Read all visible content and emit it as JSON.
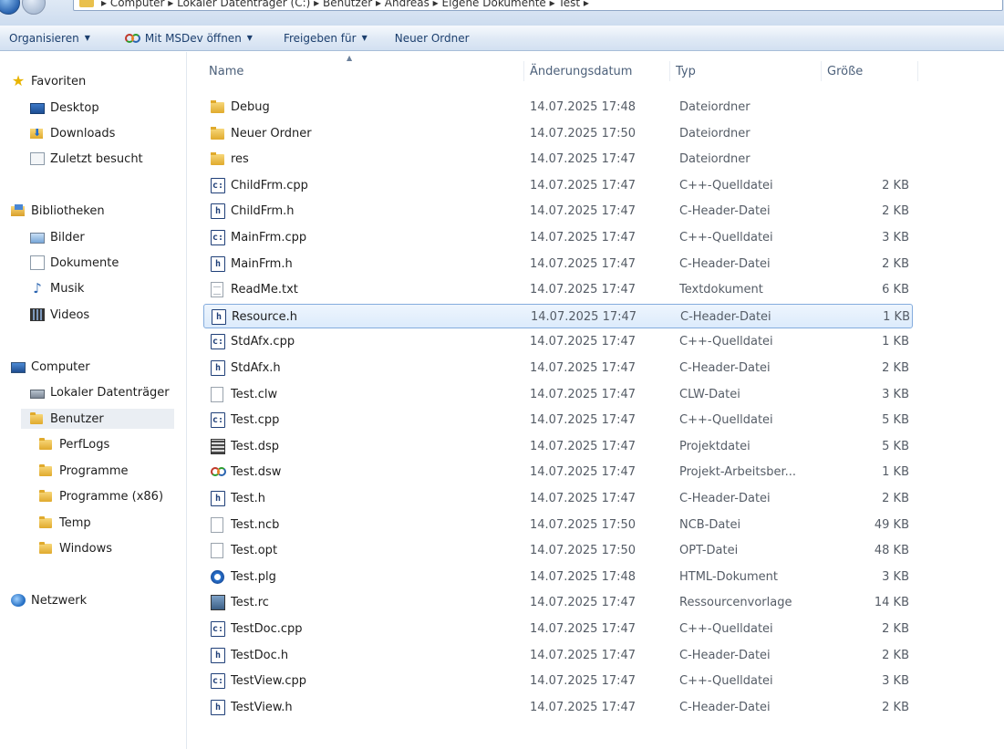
{
  "address": {
    "path": "▸ Computer ▸ Lokaler Datenträger (C:) ▸ Benutzer ▸ Andreas ▸ Eigene Dokumente ▸ Test ▸"
  },
  "toolbar": {
    "organize": "Organisieren",
    "open_with": "Mit MSDev öffnen",
    "share": "Freigeben für",
    "new_folder": "Neuer Ordner"
  },
  "nav": {
    "favorites": "Favoriten",
    "desktop": "Desktop",
    "downloads": "Downloads",
    "recent": "Zuletzt besucht",
    "libraries": "Bibliotheken",
    "pictures": "Bilder",
    "documents": "Dokumente",
    "music": "Musik",
    "videos": "Videos",
    "computer": "Computer",
    "drive": "Lokaler Datenträger",
    "benutzer": "Benutzer",
    "perflogs": "PerfLogs",
    "programme": "Programme",
    "programme_x86": "Programme (x86)",
    "temp": "Temp",
    "windows": "Windows",
    "network": "Netzwerk"
  },
  "columns": {
    "name": "Name",
    "date": "Änderungsdatum",
    "type": "Typ",
    "size": "Größe"
  },
  "files": [
    {
      "name": "Debug",
      "date": "14.07.2025 17:48",
      "type": "Dateiordner",
      "size": "",
      "icon": "folder-icon"
    },
    {
      "name": "Neuer Ordner",
      "date": "14.07.2025 17:50",
      "type": "Dateiordner",
      "size": "",
      "icon": "folder-icon"
    },
    {
      "name": "res",
      "date": "14.07.2025 17:47",
      "type": "Dateiordner",
      "size": "",
      "icon": "folder-icon"
    },
    {
      "name": "ChildFrm.cpp",
      "date": "14.07.2025 17:47",
      "type": "C++-Quelldatei",
      "size": "2 KB",
      "icon": "cpp-file-icon"
    },
    {
      "name": "ChildFrm.h",
      "date": "14.07.2025 17:47",
      "type": "C-Header-Datei",
      "size": "2 KB",
      "icon": "header-file-icon"
    },
    {
      "name": "MainFrm.cpp",
      "date": "14.07.2025 17:47",
      "type": "C++-Quelldatei",
      "size": "3 KB",
      "icon": "cpp-file-icon"
    },
    {
      "name": "MainFrm.h",
      "date": "14.07.2025 17:47",
      "type": "C-Header-Datei",
      "size": "2 KB",
      "icon": "header-file-icon"
    },
    {
      "name": "ReadMe.txt",
      "date": "14.07.2025 17:47",
      "type": "Textdokument",
      "size": "6 KB",
      "icon": "text-file-icon"
    },
    {
      "name": "Resource.h",
      "date": "14.07.2025 17:47",
      "type": "C-Header-Datei",
      "size": "1 KB",
      "icon": "header-file-icon"
    },
    {
      "name": "StdAfx.cpp",
      "date": "14.07.2025 17:47",
      "type": "C++-Quelldatei",
      "size": "1 KB",
      "icon": "cpp-file-icon"
    },
    {
      "name": "StdAfx.h",
      "date": "14.07.2025 17:47",
      "type": "C-Header-Datei",
      "size": "2 KB",
      "icon": "header-file-icon"
    },
    {
      "name": "Test.clw",
      "date": "14.07.2025 17:47",
      "type": "CLW-Datei",
      "size": "3 KB",
      "icon": "blank-file-icon"
    },
    {
      "name": "Test.cpp",
      "date": "14.07.2025 17:47",
      "type": "C++-Quelldatei",
      "size": "5 KB",
      "icon": "cpp-file-icon"
    },
    {
      "name": "Test.dsp",
      "date": "14.07.2025 17:47",
      "type": "Projektdatei",
      "size": "5 KB",
      "icon": "project-file-icon"
    },
    {
      "name": "Test.dsw",
      "date": "14.07.2025 17:47",
      "type": "Projekt-Arbeitsber...",
      "size": "1 KB",
      "icon": "workspace-file-icon"
    },
    {
      "name": "Test.h",
      "date": "14.07.2025 17:47",
      "type": "C-Header-Datei",
      "size": "2 KB",
      "icon": "header-file-icon"
    },
    {
      "name": "Test.ncb",
      "date": "14.07.2025 17:50",
      "type": "NCB-Datei",
      "size": "49 KB",
      "icon": "blank-file-icon"
    },
    {
      "name": "Test.opt",
      "date": "14.07.2025 17:50",
      "type": "OPT-Datei",
      "size": "48 KB",
      "icon": "blank-file-icon"
    },
    {
      "name": "Test.plg",
      "date": "14.07.2025 17:48",
      "type": "HTML-Dokument",
      "size": "3 KB",
      "icon": "html-file-icon"
    },
    {
      "name": "Test.rc",
      "date": "14.07.2025 17:47",
      "type": "Ressourcenvorlage",
      "size": "14 KB",
      "icon": "resource-file-icon"
    },
    {
      "name": "TestDoc.cpp",
      "date": "14.07.2025 17:47",
      "type": "C++-Quelldatei",
      "size": "2 KB",
      "icon": "cpp-file-icon"
    },
    {
      "name": "TestDoc.h",
      "date": "14.07.2025 17:47",
      "type": "C-Header-Datei",
      "size": "2 KB",
      "icon": "header-file-icon"
    },
    {
      "name": "TestView.cpp",
      "date": "14.07.2025 17:47",
      "type": "C++-Quelldatei",
      "size": "3 KB",
      "icon": "cpp-file-icon"
    },
    {
      "name": "TestView.h",
      "date": "14.07.2025 17:47",
      "type": "C-Header-Datei",
      "size": "2 KB",
      "icon": "header-file-icon"
    }
  ],
  "selected_file": "Resource.h",
  "selected_nav": "Benutzer",
  "colors": {
    "selection_border": "#84acdd",
    "toolbar_text": "#1c3f6e"
  }
}
